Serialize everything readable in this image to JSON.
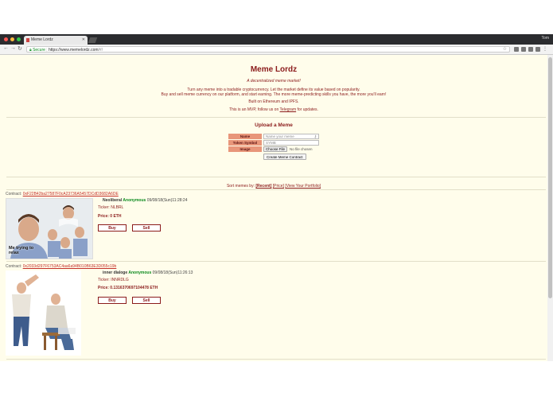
{
  "browser": {
    "tab_title": "Meme Lordz",
    "user_name": "Tom",
    "secure_label": "Secure",
    "url_main": "https://www.memelordz.com",
    "url_path": "/#/"
  },
  "header": {
    "title": "Meme Lordz",
    "tagline": "A decentralized meme market!",
    "intro_line1": "Turn any meme into a tradable cryptocurrency. Let the market define its value based on popularity.",
    "intro_line2": "Buy and sell meme currency on our platform, and start earning. The more meme-predicting skills you have, the more you'll earn!",
    "built_on": "Built on Ethereum and IPFS.",
    "mvp_prefix": "This is an MVP, follow us on ",
    "mvp_link": "Telegram",
    "mvp_suffix": " for updates."
  },
  "upload": {
    "title": "Upload a Meme",
    "name_label": "Name",
    "name_placeholder": "Name your meme",
    "symbol_label": "Token Symbol",
    "symbol_placeholder": "SYMB",
    "image_label": "Image",
    "choose_file": "Choose File",
    "no_file": "No file chosen",
    "create_button": "Create Meme Contract"
  },
  "sort": {
    "prefix": "Sort memes by:",
    "recent": "[Recent]",
    "price": "[Price]",
    "portfolio": "[View Your Portfolio]"
  },
  "memes": [
    {
      "contract_label": "Contract:",
      "contract": "0xF22B42ba27587F0cA23736A5457DCdD3682A6DE",
      "image_caption": "Me trying to relax",
      "title": "Neoliberal",
      "author": "Anonymous",
      "timestamp": "09/08/18(Sun)11:28:24",
      "ticker_label": "Ticker:",
      "ticker": "NLBRL",
      "price_label": "Price:",
      "price": "0 ETH",
      "buy": "Buy",
      "sell": "Sell"
    },
    {
      "contract_label": "Contract:",
      "contract": "0x2033d297F6753AC4aa6a94B010B63E3D055c19b",
      "title": "inner dialoge",
      "author": "Anonymous",
      "timestamp": "09/08/18(Sun)11:26:13",
      "ticker_label": "Ticker:",
      "ticker": "INNRDLG",
      "price_label": "Price:",
      "price": "0.1316370697104478 ETH",
      "buy": "Buy",
      "sell": "Sell"
    }
  ]
}
